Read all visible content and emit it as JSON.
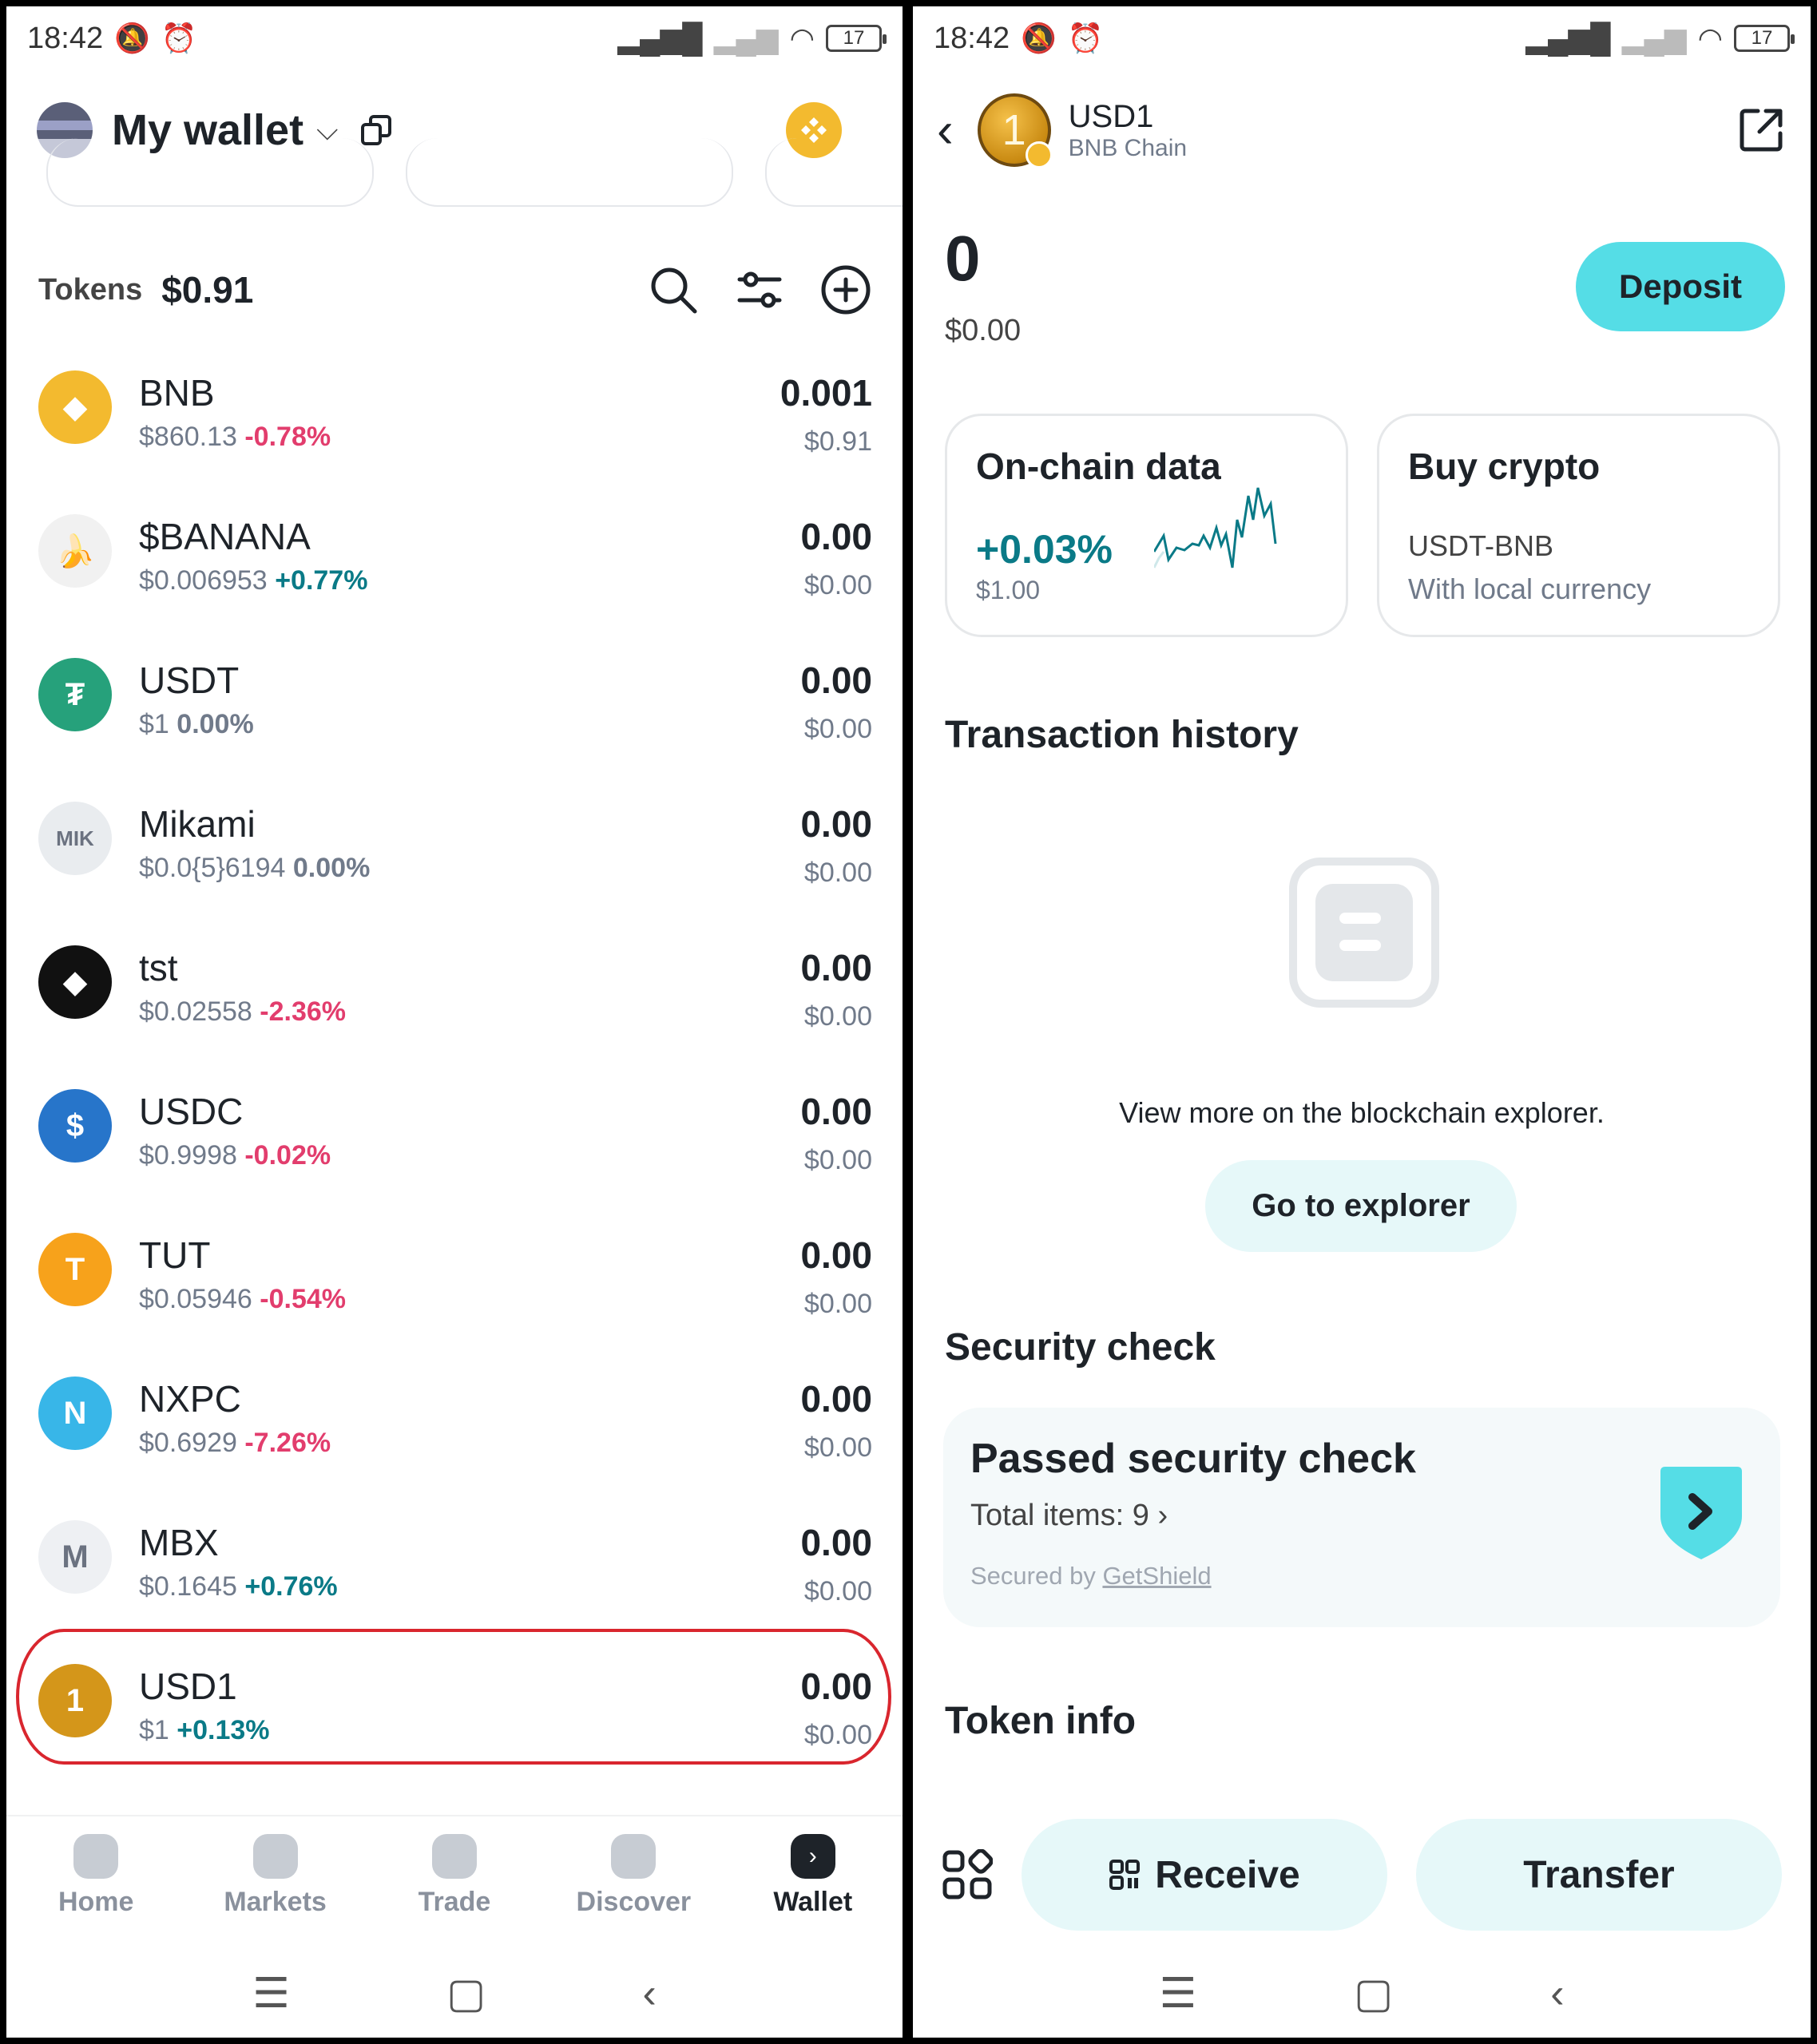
{
  "status_bar": {
    "time": "18:42",
    "battery": "17"
  },
  "left": {
    "wallet_title": "My wallet",
    "tokens_label": "Tokens",
    "tokens_total": "$0.91",
    "tokens": [
      {
        "name": "BNB",
        "price": "$860.13",
        "change": "-0.78%",
        "trend": "neg",
        "balance": "0.001",
        "value": "$0.91",
        "icon": "bnb-icon",
        "color": "#f3ba2f",
        "glyph": "◆"
      },
      {
        "name": "$BANANA",
        "price": "$0.006953",
        "change": "+0.77%",
        "trend": "pos",
        "balance": "0.00",
        "value": "$0.00",
        "icon": "banana-icon",
        "color": "#f1f1f1",
        "glyph": "🍌"
      },
      {
        "name": "USDT",
        "price": "$1",
        "change": "0.00%",
        "trend": "zer",
        "balance": "0.00",
        "value": "$0.00",
        "icon": "usdt-icon",
        "color": "#26a17b",
        "glyph": "₮"
      },
      {
        "name": "Mikami",
        "price": "$0.0{5}6194",
        "change": "0.00%",
        "trend": "zer",
        "balance": "0.00",
        "value": "$0.00",
        "icon": "mikami-icon",
        "color": "#e9ecef",
        "glyph": "MIK"
      },
      {
        "name": "tst",
        "price": "$0.02558",
        "change": "-2.36%",
        "trend": "neg",
        "balance": "0.00",
        "value": "$0.00",
        "icon": "tst-icon",
        "color": "#111111",
        "glyph": "◆"
      },
      {
        "name": "USDC",
        "price": "$0.9998",
        "change": "-0.02%",
        "trend": "neg",
        "balance": "0.00",
        "value": "$0.00",
        "icon": "usdc-icon",
        "color": "#2775ca",
        "glyph": "$"
      },
      {
        "name": "TUT",
        "price": "$0.05946",
        "change": "-0.54%",
        "trend": "neg",
        "balance": "0.00",
        "value": "$0.00",
        "icon": "tut-icon",
        "color": "#f7a21b",
        "glyph": "T"
      },
      {
        "name": "NXPC",
        "price": "$0.6929",
        "change": "-7.26%",
        "trend": "neg",
        "balance": "0.00",
        "value": "$0.00",
        "icon": "nxpc-icon",
        "color": "#38b6e8",
        "glyph": "N"
      },
      {
        "name": "MBX",
        "price": "$0.1645",
        "change": "+0.76%",
        "trend": "pos",
        "balance": "0.00",
        "value": "$0.00",
        "icon": "mbx-icon",
        "color": "#eef0f3",
        "glyph": "M"
      },
      {
        "name": "USD1",
        "price": "$1",
        "change": "+0.13%",
        "trend": "pos",
        "balance": "0.00",
        "value": "$0.00",
        "icon": "usd1-icon",
        "color": "#d4961a",
        "glyph": "1"
      }
    ],
    "nav": [
      {
        "label": "Home",
        "icon": "home-icon",
        "active": false
      },
      {
        "label": "Markets",
        "icon": "markets-icon",
        "active": false
      },
      {
        "label": "Trade",
        "icon": "trade-icon",
        "active": false
      },
      {
        "label": "Discover",
        "icon": "discover-icon",
        "active": false
      },
      {
        "label": "Wallet",
        "icon": "wallet-icon",
        "active": true
      }
    ]
  },
  "right": {
    "token_name": "USD1",
    "chain": "BNB Chain",
    "balance": "0",
    "balance_usd": "$0.00",
    "deposit_label": "Deposit",
    "onchain_card": {
      "title": "On-chain data",
      "change": "+0.03%",
      "price": "$1.00"
    },
    "buy_card": {
      "title": "Buy crypto",
      "pair": "USDT-BNB",
      "subtitle": "With local currency"
    },
    "tx_history_title": "Transaction history",
    "explorer_text": "View more on the blockchain explorer.",
    "explorer_button": "Go to explorer",
    "security_title": "Security check",
    "security_card": {
      "title": "Passed security check",
      "items": "Total items: 9",
      "secured_by_prefix": "Secured by ",
      "secured_by": "GetShield"
    },
    "token_info_title": "Token info",
    "receive_label": "Receive",
    "transfer_label": "Transfer"
  },
  "colors": {
    "accent": "#55dde6",
    "positive": "#0a7a87",
    "negative": "#e23d6d",
    "highlight_border": "#d9262e"
  }
}
